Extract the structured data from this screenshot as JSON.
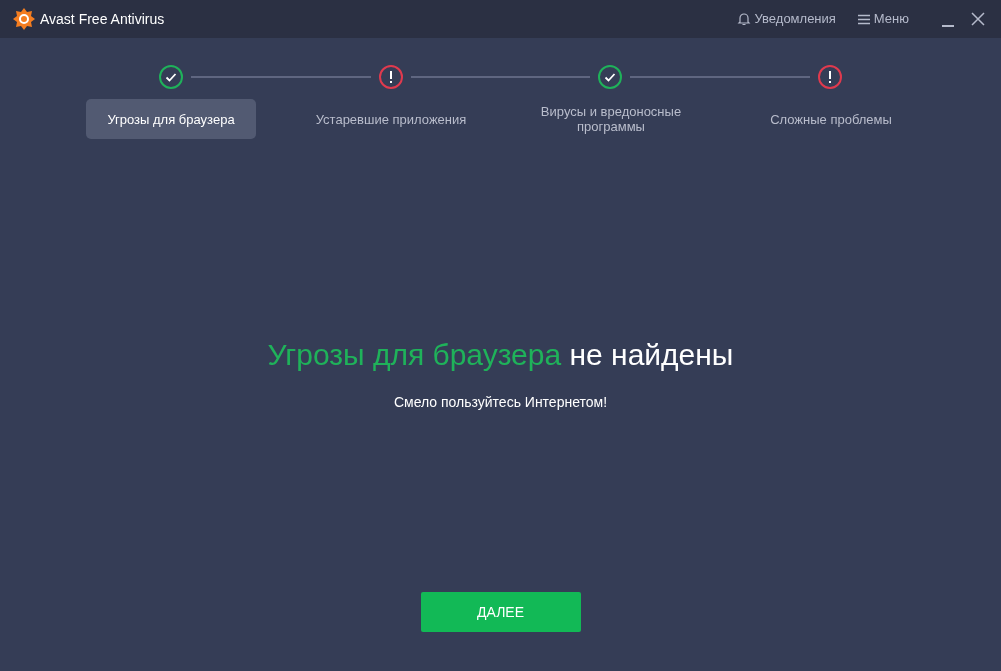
{
  "window": {
    "title": "Avast Free Antivirus",
    "actions": [
      "Уведомления",
      "Меню"
    ]
  },
  "steps": [
    {
      "label": "Угрозы для браузера",
      "kind": "ok",
      "selected": true
    },
    {
      "label": "Устаревшие приложения",
      "kind": "warning",
      "selected": false
    },
    {
      "label": "Вирусы и вредоносные программы",
      "kind": "ok",
      "selected": false
    },
    {
      "label": "Сложные проблемы",
      "kind": "warning",
      "selected": false
    }
  ],
  "result": {
    "highlight": "Угрозы для браузера",
    "rest": "не найдены",
    "subtitle": "Смело пользуйтесь Интернетом!"
  },
  "button": "ДАЛЕЕ"
}
